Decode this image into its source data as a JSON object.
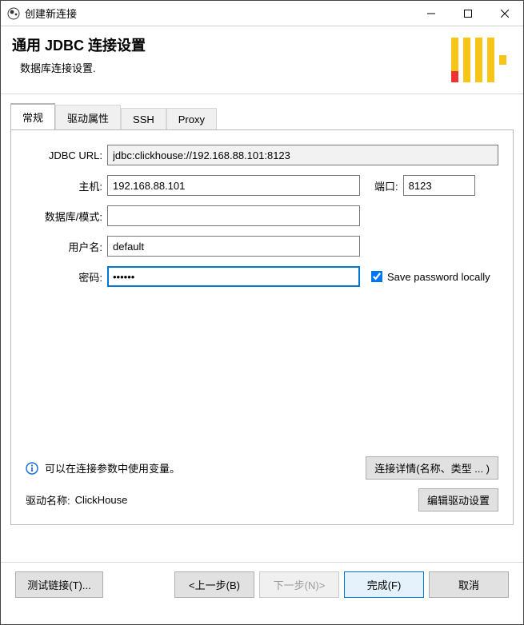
{
  "window": {
    "title": "创建新连接"
  },
  "header": {
    "title": "通用 JDBC 连接设置",
    "subtitle": "数据库连接设置."
  },
  "tabs": [
    "常规",
    "驱动属性",
    "SSH",
    "Proxy"
  ],
  "form": {
    "jdbc_label": "JDBC URL:",
    "jdbc_value": "jdbc:clickhouse://192.168.88.101:8123",
    "host_label": "主机:",
    "host_value": "192.168.88.101",
    "port_label": "端口:",
    "port_value": "8123",
    "db_label": "数据库/模式:",
    "db_value": "",
    "user_label": "用户名:",
    "user_value": "default",
    "pwd_label": "密码:",
    "pwd_value": "••••••",
    "save_pwd_label": "Save password locally",
    "save_pwd_checked": true
  },
  "info": {
    "text": "可以在连接参数中使用变量。",
    "details_btn": "连接详情(名称、类型 ... )"
  },
  "driver": {
    "label": "驱动名称:",
    "name": "ClickHouse",
    "edit_btn": "编辑驱动设置"
  },
  "footer": {
    "test": "测试链接(T)...",
    "back": "<上一步(B)",
    "next": "下一步(N)>",
    "finish": "完成(F)",
    "cancel": "取消"
  }
}
